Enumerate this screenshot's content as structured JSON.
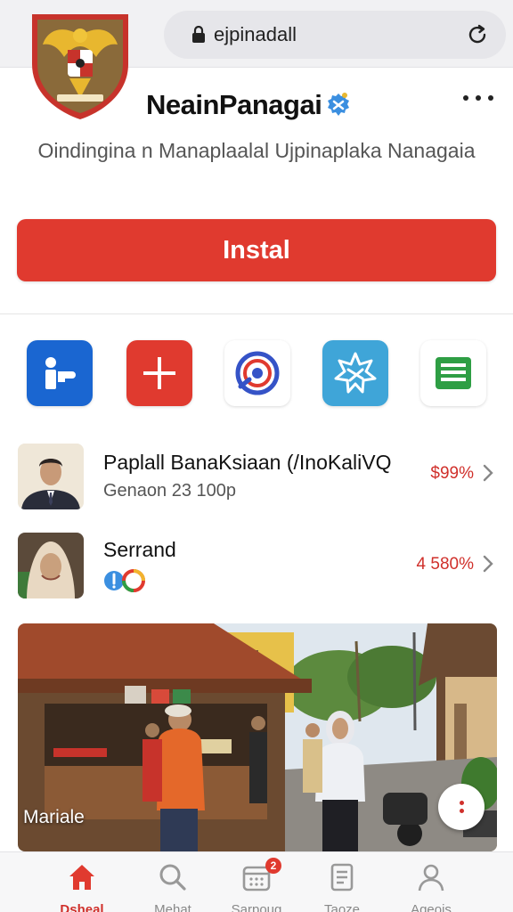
{
  "browser": {
    "url": "ejpinadall"
  },
  "header": {
    "app_title": "NeainPanagai",
    "subtitle": "Oindingina n Manaplaalal Ujpinaplaka Nanagaia"
  },
  "install": {
    "label": "Instal"
  },
  "icons": [
    {
      "name": "person-info-icon",
      "color": "#1a66d1"
    },
    {
      "name": "plus-icon",
      "color": "#e03a2f"
    },
    {
      "name": "chrome-like-icon",
      "color": "#ffffff"
    },
    {
      "name": "star-badge-icon",
      "color": "#3fa5d8"
    },
    {
      "name": "sheets-icon",
      "color": "#ffffff"
    }
  ],
  "list": [
    {
      "title": "Paplall BanaKsiaan (/InoKaliVQ",
      "subtitle": "Genaon 23 100p",
      "price": "$99%"
    },
    {
      "title": "Serrand",
      "subtitle": "",
      "price": "4 580%"
    }
  ],
  "photo": {
    "caption": "Mariale"
  },
  "nav": {
    "items": [
      {
        "label": "Dsheal",
        "icon": "home-icon",
        "active": true
      },
      {
        "label": "Mehat",
        "icon": "search-icon",
        "active": false
      },
      {
        "label": "Sarpoug",
        "icon": "calendar-icon",
        "active": false,
        "badge": "2"
      },
      {
        "label": "Taoze",
        "icon": "document-icon",
        "active": false
      },
      {
        "label": "Ageois",
        "icon": "profile-icon",
        "active": false
      }
    ]
  },
  "colors": {
    "accent": "#e03a2f",
    "price": "#d0302b",
    "verified": "#3b8fe0"
  }
}
